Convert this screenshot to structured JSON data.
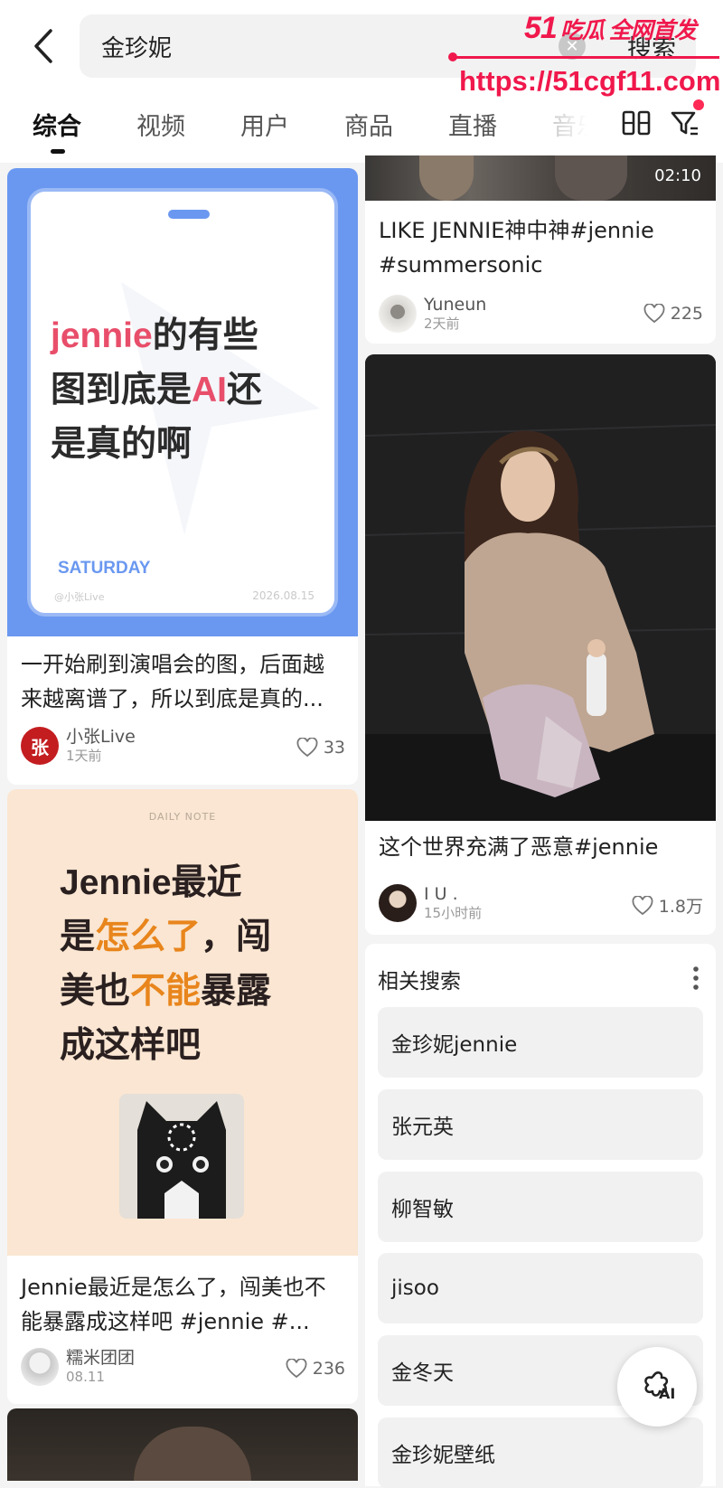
{
  "search": {
    "query": "金珍妮",
    "button": "搜索"
  },
  "watermark": {
    "brand": "51",
    "brand_cn": "吃瓜 全网首发",
    "url": "https://51cgf11.com"
  },
  "tabs": [
    {
      "label": "综合",
      "active": true
    },
    {
      "label": "视频"
    },
    {
      "label": "用户"
    },
    {
      "label": "商品"
    },
    {
      "label": "直播"
    },
    {
      "label": "音乐"
    }
  ],
  "cards": {
    "c1": {
      "title": "一开始刷到演唱会的图，后面越来越离谱了，所以到底是真的...",
      "author": "小张Live",
      "time": "1天前",
      "likes": "33",
      "avatar_text": "张",
      "img": {
        "l1a": "jennie",
        "l1b": "的有些",
        "l2a": "图到底是",
        "l2b": "AI",
        "l2c": "还",
        "l3": "是真的啊",
        "tag": "SATURDAY",
        "handle": "@小张Live",
        "date": "2026.08.15"
      }
    },
    "c2": {
      "title": "Jennie最近是怎么了，闯美也不能暴露成这样吧 #jennie #...",
      "author": "糯米团团",
      "time": "08.11",
      "likes": "236",
      "img": {
        "note": "DAILY NOTE",
        "l1": "Jennie最近",
        "l2a": "是",
        "l2b": "怎么了",
        "l2c": "，闯",
        "l3a": "美也",
        "l3b": "不能",
        "l3c": "暴露",
        "l4": "成这样吧"
      }
    },
    "v1": {
      "title": "LIKE JENNIE神中神#jennie #summersonic",
      "author": "Yuneun",
      "time": "2天前",
      "likes": "225",
      "duration": "02:10"
    },
    "v2": {
      "title": "这个世界充满了恶意#jennie",
      "author": "I U .",
      "time": "15小时前",
      "likes": "1.8万"
    }
  },
  "related": {
    "title": "相关搜索",
    "items": [
      "金珍妮jennie",
      "张元英",
      "柳智敏",
      "jisoo",
      "金冬天",
      "金珍妮壁纸"
    ]
  },
  "ai_button": {
    "label": "AI"
  },
  "colors": {
    "accent": "#ff2a55",
    "c1_frame": "#6a98f0",
    "c1_pink": "#e84e6a",
    "c2_orange": "#e8851c",
    "c2_bg": "#fae6d2"
  }
}
